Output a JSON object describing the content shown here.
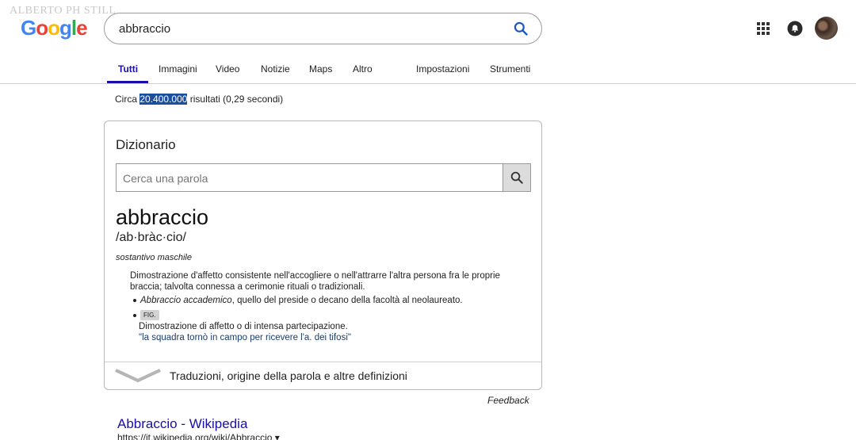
{
  "watermark": "ALBERTO PH STILL",
  "logo": {
    "letters": [
      "G",
      "o",
      "o",
      "g",
      "l",
      "e"
    ],
    "colors": [
      "#4285f4",
      "#ea4335",
      "#fbbc05",
      "#4285f4",
      "#34a853",
      "#ea4335"
    ]
  },
  "search": {
    "query": "abbraccio"
  },
  "tabs": [
    {
      "label": "Tutti"
    },
    {
      "label": "Immagini"
    },
    {
      "label": "Video"
    },
    {
      "label": "Notizie"
    },
    {
      "label": "Maps"
    },
    {
      "label": "Altro"
    },
    {
      "label": "Impostazioni"
    },
    {
      "label": "Strumenti"
    }
  ],
  "stats": {
    "prefix": "Circa",
    "count": "20.400.000",
    "suffix": "risultati (0,29 secondi)"
  },
  "dictionary": {
    "title": "Dizionario",
    "search_placeholder": "Cerca una parola",
    "word": "abbraccio",
    "phonetic": "/ab·bràc·cio/",
    "part_of_speech": "sostantivo maschile",
    "definition": "Dimostrazione d'affetto consistente nell'accogliere o nell'attrarre l'altra persona fra le proprie braccia; talvolta connessa a cerimonie rituali o tradizionali.",
    "sub_def_term": "Abbraccio accademico",
    "sub_def_rest": ", quello del preside o decano della facoltà al neolaureato.",
    "fig_tag": "FIG.",
    "fig_definition": "Dimostrazione di affetto o di intensa partecipazione.",
    "example": "\"la squadra tornò in campo per ricevere l'a. dei tifosi\"",
    "more_link": "Traduzioni, origine della parola e altre definizioni"
  },
  "feedback": "Feedback",
  "result": {
    "title": "Abbraccio - Wikipedia",
    "url": "https://it.wikipedia.org/wiki/Abbraccio ▾"
  },
  "colors": {
    "link": "#1a0dab",
    "highlight": "#1a4fa0"
  }
}
